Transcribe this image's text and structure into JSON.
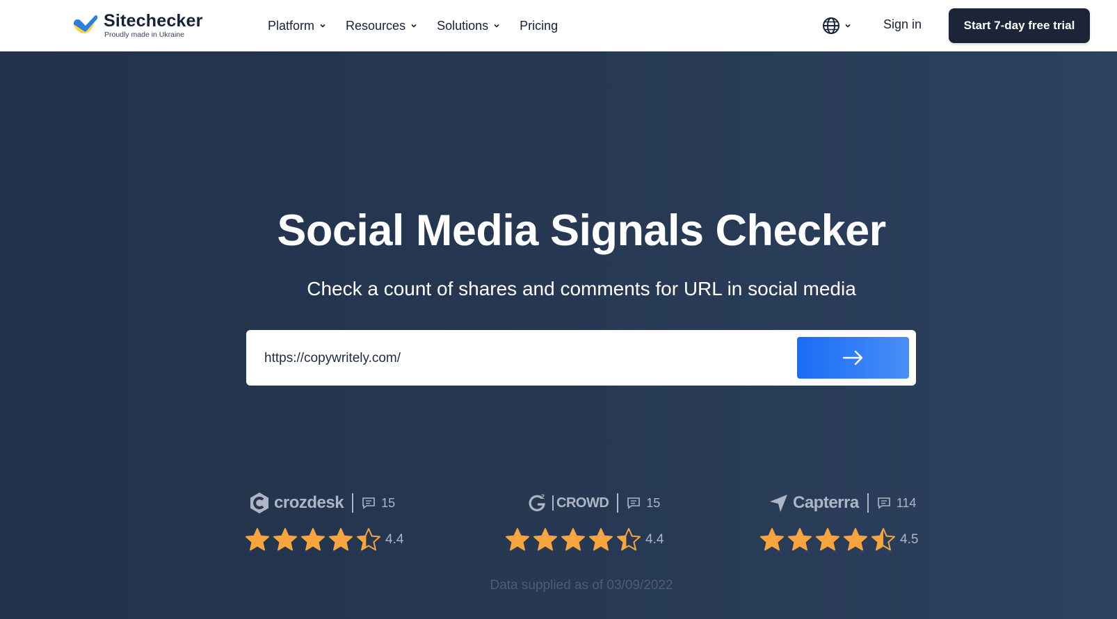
{
  "header": {
    "brand": "Sitechecker",
    "tagline": "Proudly made in Ukraine",
    "nav": [
      {
        "label": "Platform",
        "has_dropdown": true
      },
      {
        "label": "Resources",
        "has_dropdown": true
      },
      {
        "label": "Solutions",
        "has_dropdown": true
      },
      {
        "label": "Pricing",
        "has_dropdown": false
      }
    ],
    "language_icon": "globe-icon",
    "signin_label": "Sign in",
    "trial_label": "Start 7-day free trial"
  },
  "hero": {
    "title": "Social Media Signals Checker",
    "subtitle": "Check a count of shares and comments for URL in social media",
    "url_value": "https://copywritely.com/",
    "submit_icon": "arrow-right-icon"
  },
  "ratings": [
    {
      "platform": "crozdesk",
      "reviews": "15",
      "score": "4.4",
      "stars": 4.4
    },
    {
      "platform": "CROWD",
      "reviews": "15",
      "score": "4.4",
      "stars": 4.4
    },
    {
      "platform": "Capterra",
      "reviews": "114",
      "score": "4.5",
      "stars": 4.5
    }
  ],
  "footnote": "Data supplied as of 03/09/2022",
  "colors": {
    "accent": "#1a6cf5",
    "star": "#f7a53c",
    "hero_bg": "#253650",
    "dark_button": "#1b2537"
  }
}
